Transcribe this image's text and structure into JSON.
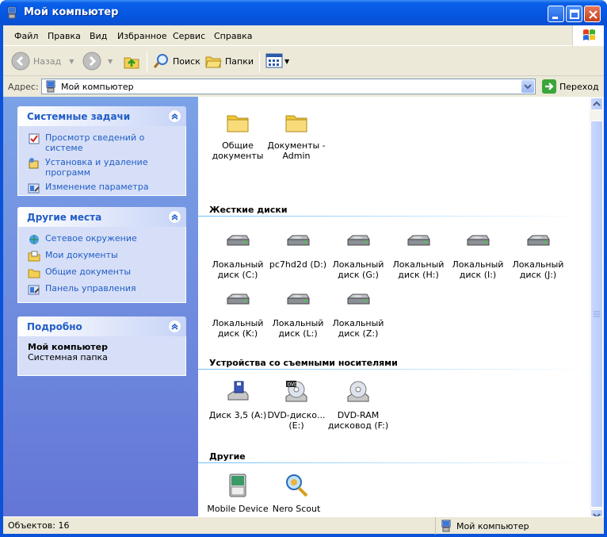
{
  "window": {
    "title": "Мой компьютер"
  },
  "menubar": {
    "items": [
      "Файл",
      "Правка",
      "Вид",
      "Избранное",
      "Сервис",
      "Справка"
    ]
  },
  "toolbar": {
    "back": "Назад",
    "search": "Поиск",
    "folders": "Папки"
  },
  "address": {
    "label": "Адрес:",
    "value": "Мой компьютер",
    "go": "Переход"
  },
  "sidebar": {
    "system_tasks": {
      "title": "Системные задачи",
      "links": [
        "Просмотр сведений о системе",
        "Установка и удаление программ",
        "Изменение параметра"
      ]
    },
    "other_places": {
      "title": "Другие места",
      "links": [
        "Сетевое окружение",
        "Мои документы",
        "Общие документы",
        "Панель управления"
      ]
    },
    "details": {
      "title": "Подробно",
      "name": "Мой компьютер",
      "desc": "Системная папка"
    }
  },
  "main": {
    "files": [
      {
        "label": "Общие документы",
        "icon": "folder-icon"
      },
      {
        "label": "Документы - Admin",
        "icon": "folder-icon"
      }
    ],
    "hard_drives_title": "Жесткие диски",
    "hard_drives": [
      "Локальный диск (C:)",
      "pc7hd2d (D:)",
      "Локальный диск (G:)",
      "Локальный диск (H:)",
      "Локальный диск (I:)",
      "Локальный диск (J:)",
      "Локальный диск (K:)",
      "Локальный диск (L:)",
      "Локальный диск (Z:)"
    ],
    "removable_title": "Устройства со съемными носителями",
    "removable": [
      "Диск 3,5 (A:)",
      "DVD-диско... (E:)",
      "DVD-RAM дисковод (F:)"
    ],
    "other_title": "Другие",
    "other": [
      "Mobile Device",
      "Nero Scout"
    ]
  },
  "status": {
    "left": "Объектов: 16",
    "right": "Мой компьютер"
  }
}
